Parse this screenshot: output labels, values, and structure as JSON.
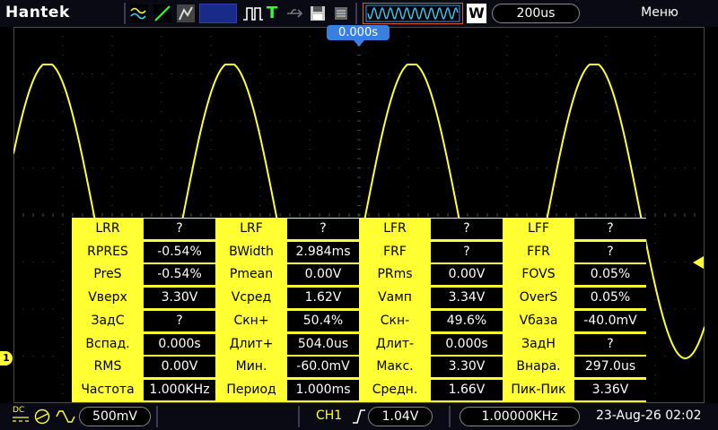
{
  "top": {
    "brand": "Hantek",
    "timebase": "200us",
    "menu": "Меню",
    "trigger_position": "0.000s",
    "run_mode_letter": "T",
    "acq_letter": "W"
  },
  "measurements": [
    [
      {
        "n": "LRR",
        "v": "?"
      },
      {
        "n": "LRF",
        "v": "?"
      },
      {
        "n": "LFR",
        "v": "?"
      },
      {
        "n": "LFF",
        "v": "?"
      }
    ],
    [
      {
        "n": "RPRES",
        "v": "-0.54%"
      },
      {
        "n": "BWidth",
        "v": "2.984ms"
      },
      {
        "n": "FRF",
        "v": "?"
      },
      {
        "n": "FFR",
        "v": "?"
      }
    ],
    [
      {
        "n": "PreS",
        "v": "-0.54%"
      },
      {
        "n": "Pmean",
        "v": "0.00V"
      },
      {
        "n": "PRms",
        "v": "0.00V"
      },
      {
        "n": "FOVS",
        "v": "0.05%"
      }
    ],
    [
      {
        "n": "Vверх",
        "v": "3.30V"
      },
      {
        "n": "Vсред",
        "v": "1.62V"
      },
      {
        "n": "Vамп",
        "v": "3.34V"
      },
      {
        "n": "OverS",
        "v": "0.05%"
      }
    ],
    [
      {
        "n": "ЗадС",
        "v": "?"
      },
      {
        "n": "Скн+",
        "v": "50.4%"
      },
      {
        "n": "Скн-",
        "v": "49.6%"
      },
      {
        "n": "Vбаза",
        "v": "-40.0mV"
      }
    ],
    [
      {
        "n": "Вспад.",
        "v": "0.000s"
      },
      {
        "n": "Длит+",
        "v": "504.0us"
      },
      {
        "n": "Длит-",
        "v": "0.000s"
      },
      {
        "n": "ЗадН",
        "v": "?"
      }
    ],
    [
      {
        "n": "RMS",
        "v": "0.00V"
      },
      {
        "n": "Мин.",
        "v": "-60.0mV"
      },
      {
        "n": "Макс.",
        "v": "3.30V"
      },
      {
        "n": "Внара.",
        "v": "297.0us"
      }
    ],
    [
      {
        "n": "Частота",
        "v": "1.000KHz"
      },
      {
        "n": "Период",
        "v": "1.000ms"
      },
      {
        "n": "Средн.",
        "v": "1.66V"
      },
      {
        "n": "Пик-Пик",
        "v": "3.36V"
      }
    ]
  ],
  "bottom": {
    "coupling": "DC",
    "volts_div": "500mV",
    "channel": "CH1",
    "trigger_level": "1.04V",
    "frequency": "1.00000KHz",
    "datetime": "23-Aug-26 02:02",
    "ch_marker": "1"
  },
  "colors": {
    "trace": "#ffff33",
    "grid": "#4a4a4a",
    "accent": "#3a7fe0"
  }
}
